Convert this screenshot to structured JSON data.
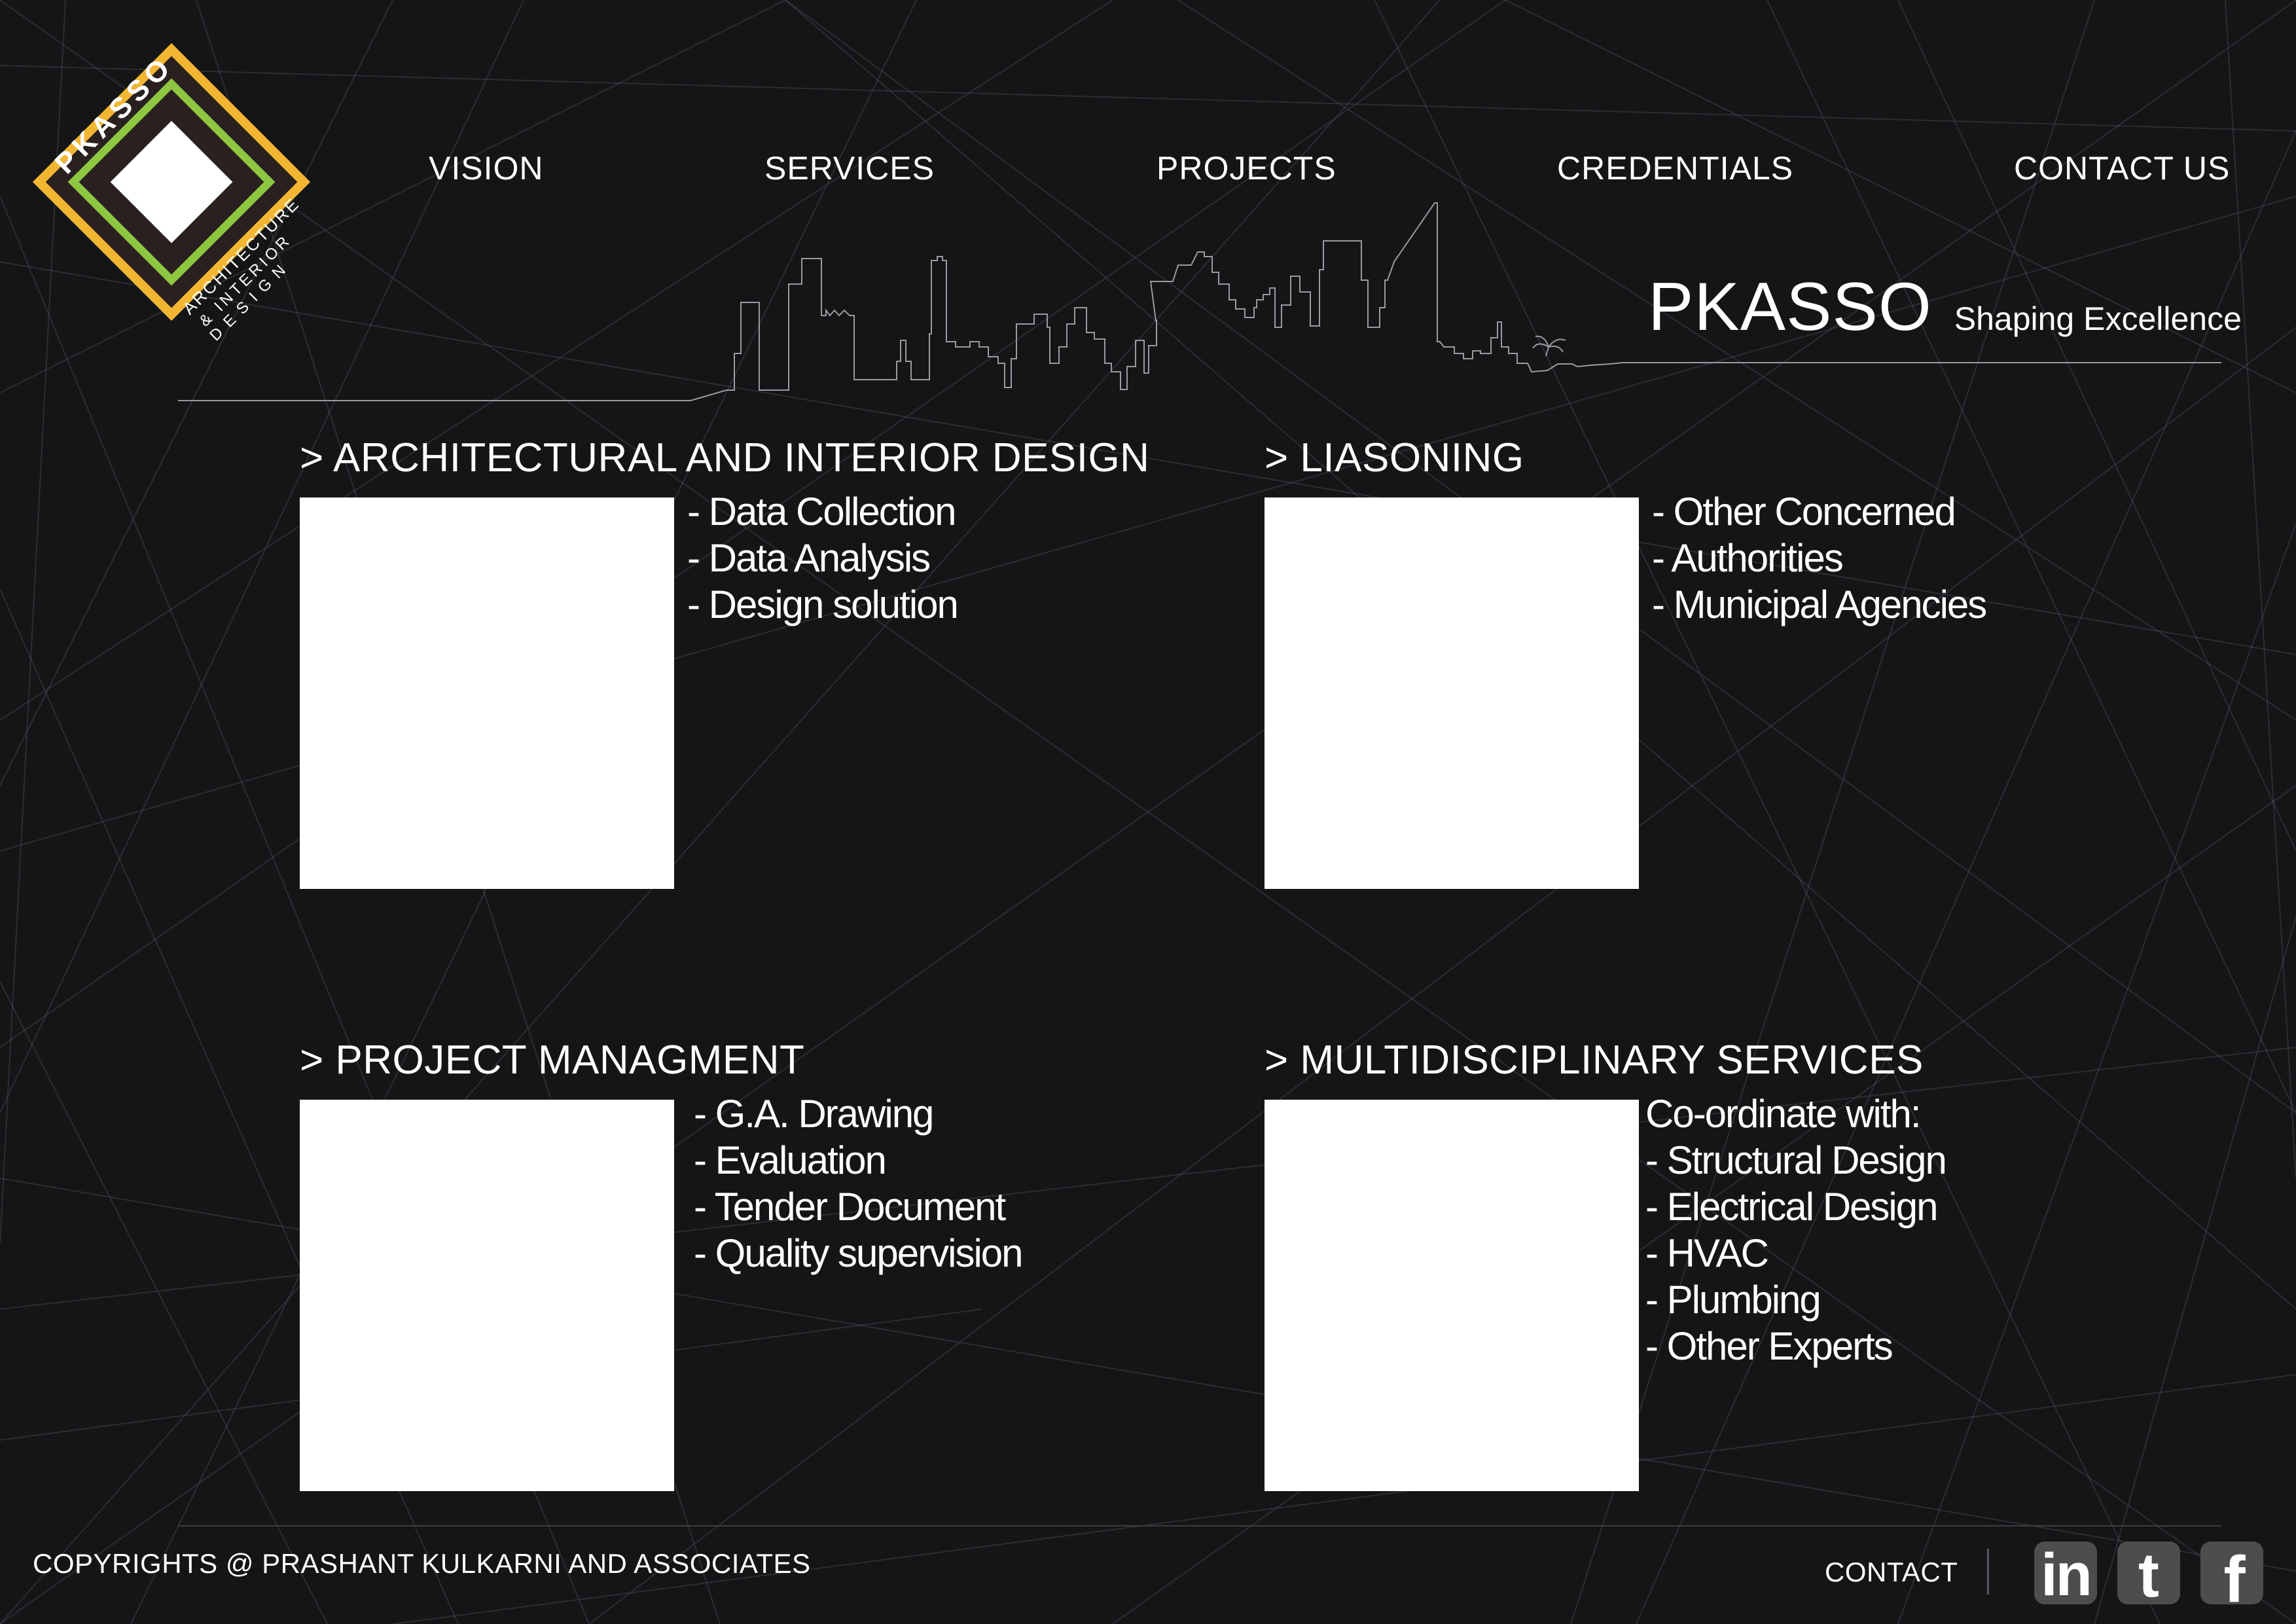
{
  "logo": {
    "brand": "PKASSO",
    "line1": "ARCHITECTURE",
    "line2": "& INTERIOR",
    "line3": "DESIGN",
    "colors": {
      "outer": "#f2b632",
      "middle": "#2b2020",
      "inner": "#8dc641",
      "core": "#ffffff"
    }
  },
  "nav": {
    "vision": "VISION",
    "services": "SERVICES",
    "projects": "PROJECTS",
    "credentials": "CREDENTIALS",
    "contact": "CONTACT US"
  },
  "brand": {
    "name": "PKASSO",
    "tagline": "Shaping Excellence"
  },
  "services": {
    "architecture": {
      "heading": "> ARCHITECTURAL AND INTERIOR DESIGN",
      "items": [
        "- Data Collection",
        "- Data Analysis",
        "- Design solution"
      ]
    },
    "liasoning": {
      "heading": "> LIASONING",
      "items": [
        "- Other Concerned",
        "- Authorities",
        "- Municipal Agencies"
      ]
    },
    "project_management": {
      "heading": "> PROJECT MANAGMENT",
      "items": [
        "- G.A. Drawing",
        "- Evaluation",
        "- Tender Document",
        "- Quality supervision"
      ]
    },
    "multidisciplinary": {
      "heading": "> MULTIDISCIPLINARY SERVICES",
      "items": [
        "Co-ordinate with:",
        "- Structural Design",
        "- Electrical Design",
        "- HVAC",
        "- Plumbing",
        "- Other Experts"
      ]
    }
  },
  "footer": {
    "copyright": "COPYRIGHTS @ PRASHANT KULKARNI AND ASSOCIATES",
    "contact": "CONTACT",
    "social": {
      "linkedin": "in",
      "twitter": "t",
      "facebook": "f"
    }
  },
  "colors": {
    "background": "#141517",
    "text": "#ffffff",
    "accent_yellow": "#f2b632",
    "accent_green": "#8dc641",
    "social_tile": "#4d4d4f"
  }
}
